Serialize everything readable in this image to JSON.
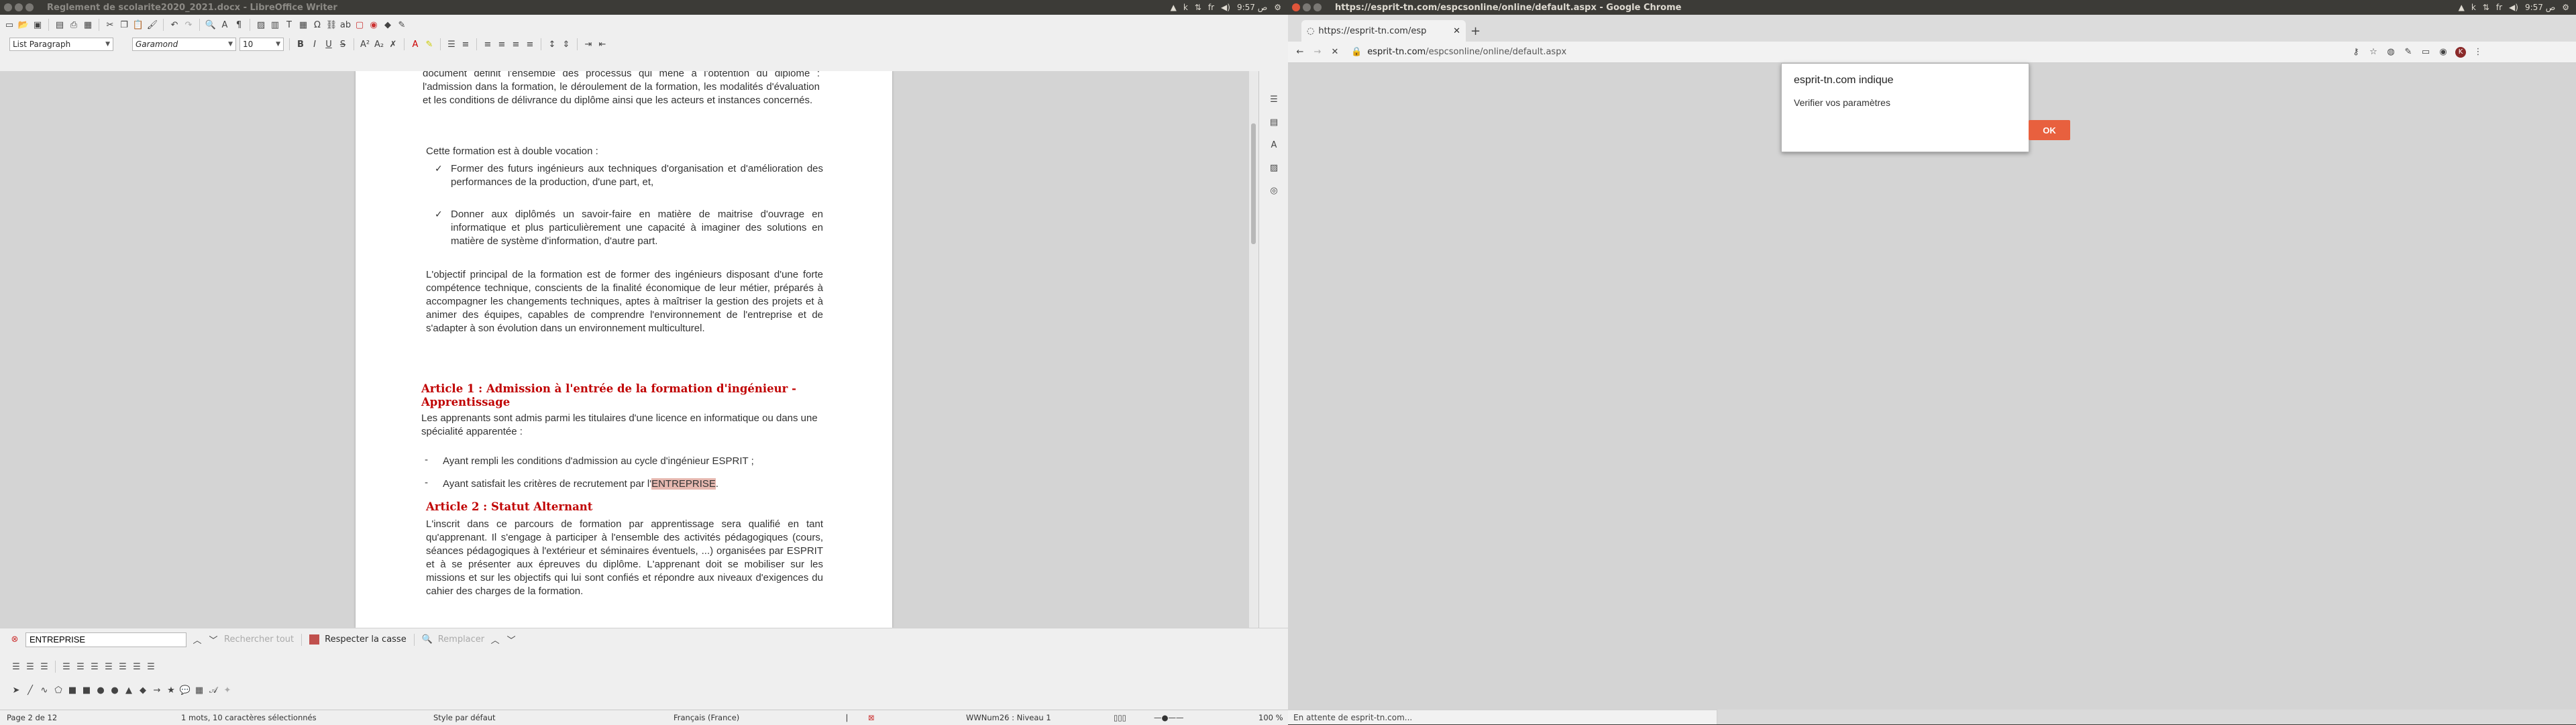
{
  "writer": {
    "window_title": "Reglement de scolarite2020_2021.docx - LibreOffice Writer",
    "tray": {
      "k": "k",
      "lang": "fr",
      "clock": "ص 9:57"
    },
    "paragraph_style": "List Paragraph",
    "font_name": "Garamond",
    "font_size": "10",
    "document": {
      "intro_lines": "document définit l'ensemble des processus qui mène à l'obtention du diplôme : l'admission dans la formation, le déroulement de la formation, les modalités d'évaluation et les conditions de délivrance du diplôme ainsi que les acteurs et instances concernés.",
      "vocation": "Cette formation est à double vocation :",
      "bullet_marker": "✓",
      "check1": "Former des futurs ingénieurs aux techniques d'organisation et d'amélioration des performances de la production, d'une part, et,",
      "check2": "Donner aux diplômés un savoir-faire en matière de maitrise d'ouvrage en informatique et plus particulièrement une capacité à imaginer des solutions en matière de système d'information, d'autre part.",
      "objectif": "L'objectif principal de la formation est de former des ingénieurs disposant d'une forte compétence technique, conscients de la finalité économique de leur métier, préparés à accompagner les changements techniques, aptes à maîtriser la gestion des projets et à animer des équipes, capables de comprendre l'environnement de l'entreprise et de s'adapter à son évolution dans un environnement multiculturel.",
      "article1_title": "Article 1 : Admission à l'entrée de la formation d'ingénieur - Apprentissage",
      "article1_text": "Les apprenants sont admis parmi les titulaires d'une licence en informatique ou dans une spécialité apparentée :",
      "dash": "-",
      "cond1": "Ayant rempli les conditions d'admission au cycle d'ingénieur ESPRIT ;",
      "cond2_prefix": "Ayant satisfait les critères de recrutement par l'",
      "cond2_highlight": "ENTREPRISE",
      "cond2_suffix": ".",
      "article2_title": "Article 2 : Statut Alternant",
      "article2_text": "L'inscrit dans ce parcours de formation par apprentissage sera qualifié en tant qu'apprenant. Il s'engage à participer à l'ensemble des activités pédagogiques (cours, séances pédagogiques à l'extérieur et séminaires éventuels, ...) organisées par ESPRIT et à se présenter aux épreuves du diplôme. L'apprenant doit se mobiliser sur les missions et sur les objectifs qui lui sont confiés et répondre aux niveaux d'exigences du cahier des charges de la formation."
    },
    "find": {
      "value": "ENTREPRISE",
      "find_all": "Rechercher tout",
      "match_case": "Respecter la casse",
      "replace": "Remplacer"
    },
    "status": {
      "page": "Page 2 de 12",
      "selection": "1 mots, 10 caractères sélectionnés",
      "style": "Style par défaut",
      "language": "Français (France)",
      "list": "WWNum26 : Niveau 1",
      "zoom": "100 %"
    }
  },
  "chrome": {
    "window_title": "https://esprit-tn.com/espcsonline/online/default.aspx - Google Chrome",
    "tray": {
      "lang": "fr",
      "clock": "ص 9:57"
    },
    "tab_title": "https://esprit-tn.com/esp",
    "url_domain": "esprit-tn.com",
    "url_path": "/espcsonline/online/default.aspx",
    "dialog": {
      "title": "esprit-tn.com indique",
      "message": "Verifier vos paramètres",
      "ok_label": "OK"
    },
    "status_text": "En attente de esprit-tn.com..."
  },
  "colors": {
    "accent": "#e8603e",
    "heading": "#c00000",
    "highlight": "#e6b8b0"
  }
}
